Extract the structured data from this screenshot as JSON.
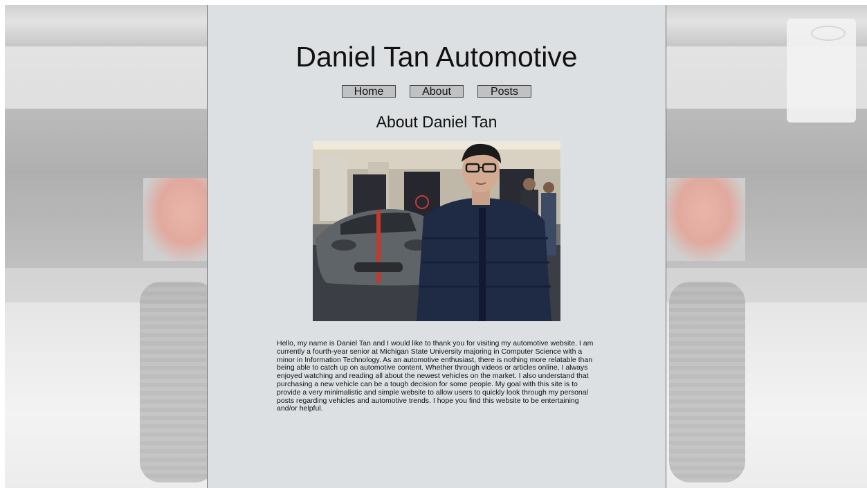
{
  "site": {
    "title": "Daniel Tan Automotive"
  },
  "nav": {
    "items": [
      {
        "label": "Home"
      },
      {
        "label": "About"
      },
      {
        "label": "Posts"
      }
    ]
  },
  "page": {
    "heading": "About Daniel Tan",
    "bio": "Hello, my name is Daniel Tan and I would like to thank you for visiting my automotive website. I am currently a fourth-year senior at Michigan State University majoring in Computer Science with a minor in Information Technology. As an automotive enthusiast, there is nothing more relatable than being able to catch up on automotive content. Whether through videos or articles online, I always enjoyed watching and reading all about the newest vehicles on the market. I also understand that purchasing a new vehicle can be a tough decision for some people. My goal with this site is to provide a very minimalistic and simple website to allow users to quickly look through my personal posts regarding vehicles and automotive trends. I hope you find this website to be entertaining and/or helpful."
  },
  "colors": {
    "panel_background": "#dde0e2",
    "nav_button": "#bfc1c3",
    "text": "#111111"
  }
}
